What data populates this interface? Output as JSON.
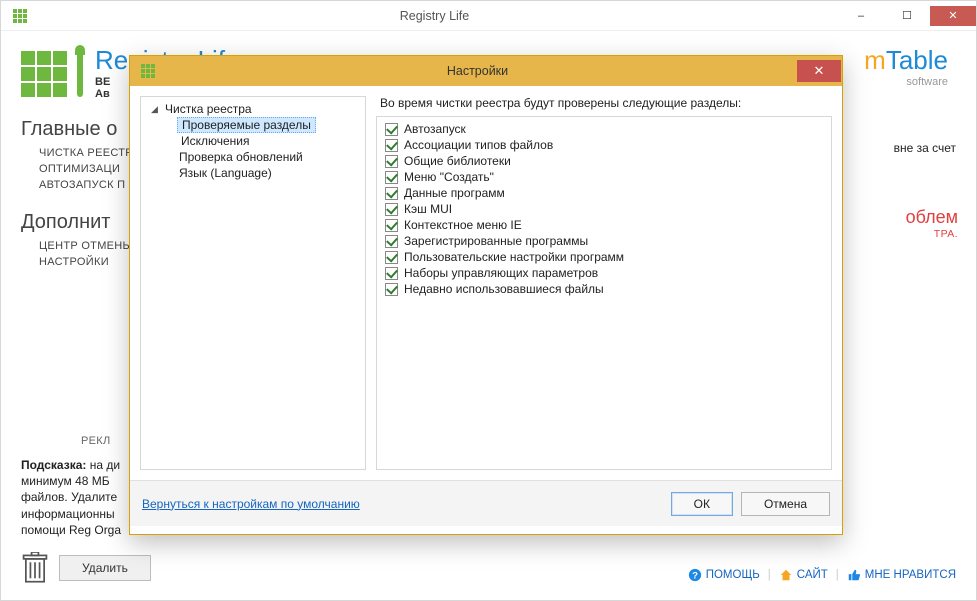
{
  "window": {
    "title": "Registry Life",
    "minimize": "–",
    "maximize": "☐",
    "close": "✕"
  },
  "header": {
    "app_title": "Registry Life",
    "subtitle_prefix": "ВЕ",
    "subtitle_cut": "Ав",
    "brand_c": "m",
    "brand_t": "Table",
    "brand_soft": "software"
  },
  "sidebar": {
    "section1": "Главные о",
    "items1": [
      "ЧИСТКА РЕЕСТР",
      "ОПТИМИЗАЦИ",
      "АВТОЗАПУСК П"
    ],
    "section2": "Дополнит",
    "items2": [
      "ЦЕНТР ОТМЕНЫ",
      "НАСТРОЙКИ"
    ]
  },
  "right_fragment": "вне за счет",
  "problems": {
    "line1": "облем",
    "line2": "ТРА."
  },
  "hint": {
    "label": "РЕКЛ",
    "bold": "Подсказка:",
    "text": " на ди\nминимум 48 МБ\nфайлов. Удалите\nинформационны\nпомощи Reg Orga"
  },
  "trash": {
    "delete": "Удалить"
  },
  "footer": {
    "help": "ПОМОЩЬ",
    "site": "САЙТ",
    "like": "МНЕ НРАВИТСЯ"
  },
  "dialog": {
    "title": "Настройки",
    "close": "✕",
    "tree": {
      "root1": "Чистка реестра",
      "child1": "Проверяемые разделы",
      "child2": "Исключения",
      "root2": "Проверка обновлений",
      "root3": "Язык (Language)"
    },
    "check_header": "Во время чистки реестра будут проверены следующие разделы:",
    "checks": [
      "Автозапуск",
      "Ассоциации типов файлов",
      "Общие библиотеки",
      "Меню \"Создать\"",
      "Данные программ",
      "Кэш MUI",
      "Контекстное меню IE",
      "Зарегистрированные программы",
      "Пользовательские настройки программ",
      "Наборы управляющих параметров",
      "Недавно использовавшиеся файлы"
    ],
    "reset": "Вернуться к настройкам по умолчанию",
    "ok": "ОК",
    "cancel": "Отмена"
  }
}
